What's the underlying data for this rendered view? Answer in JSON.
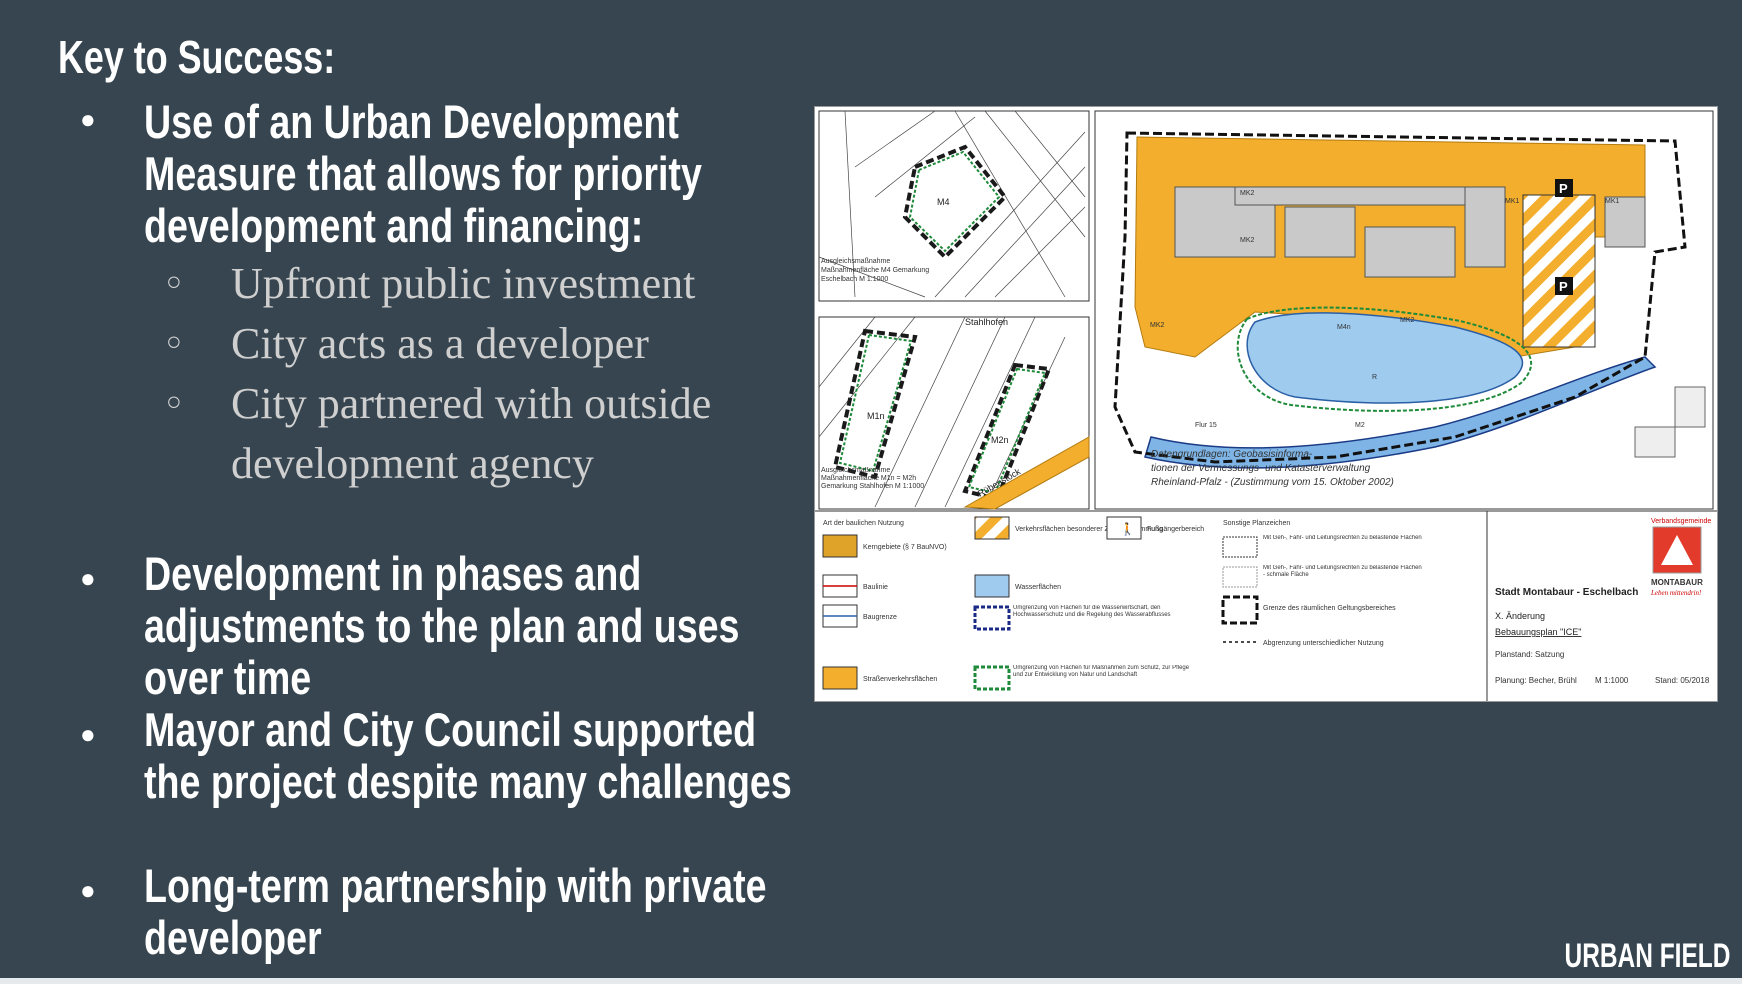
{
  "title": "Key to Success:",
  "bullets": [
    {
      "text": "Use of an Urban Development Measure that allows for priority development and financing:"
    },
    {
      "text": "Development in phases and adjustments to the plan and uses over time"
    },
    {
      "text": "Mayor and City Council supported the project despite many challenges"
    },
    {
      "text": "Long-term partnership with private developer"
    }
  ],
  "sub_bullets": [
    "Upfront public investment",
    "City acts as a developer",
    "City partnered with outside development agency"
  ],
  "footer": "URBAN FIELD",
  "map": {
    "inset1_label": "Ausgleichsmaßnahme Maßnahmenfläche M4 Gemarkung Eschelbach M 1:1000",
    "inset1_mark": "M4",
    "inset2_top": "Stahlhofen",
    "inset2_label": "Ausgleichsmaßnahme Maßnahmenfläche M1n = M2h Gemarkung Stahlhofen M 1:1000",
    "inset2_m1": "M1n",
    "inset2_m2": "M2n",
    "inset2_road": "Rübenstock",
    "main_note1": "Datengrundlagen: Geobasisinforma-",
    "main_note2": "tionen der Vermessungs- und Katasterverwaltung",
    "main_note3": "Rheinland-Pfalz - (Zustimmung vom 15. Oktober 2002)",
    "zone_labels": [
      "MK2",
      "MK2",
      "MK2",
      "MK1",
      "MK1",
      "MK2",
      "M4n",
      "M2",
      "R"
    ],
    "flur": "Flur 15",
    "legend_left": [
      "Art der baulichen Nutzung",
      "Kerngebiete (§ 7 BauNVO)",
      "Baulinie",
      "Baugrenze",
      "Straßenverkehrsflächen"
    ],
    "legend_mid": [
      "Verkehrsflächen besonderer Zweckbestimmung",
      "Fußgängerbereich",
      "Wasserflächen",
      "Umgrenzung von Flächen für die Wasserwirtschaft, den Hochwasserschutz und die Regelung des Wasserabflusses",
      "Umgrenzung von Flächen für Maßnahmen zum Schutz, zur Pflege und zur Entwicklung von Natur und Landschaft"
    ],
    "legend_right": [
      "Sonstige Planzeichen",
      "Mit Geh-, Fahr- und Leitungsrechten zu belastende Flächen",
      "Mit Geh-, Fahr- und Leitungsrechten zu belastende Flächen - schmale Fläche",
      "Grenze des räumlichen Geltungsbereiches",
      "Abgrenzung unterschiedlicher Nutzung"
    ],
    "title_block": {
      "org": "Verbandsgemeinde",
      "city": "MONTABAUR",
      "motto": "Leben mittendrin!",
      "name": "Stadt Montabaur - Eschelbach",
      "change": "X. Änderung",
      "plan": "Bebauungsplan \"ICE\"",
      "status": "Planstand: Satzung",
      "planner": "Planung: Becher, Brühl",
      "scale": "M 1:1000",
      "date": "Stand: 05/2018"
    }
  },
  "colors": {
    "background": "#36454f",
    "orange": "#f2ae2c",
    "water": "#9fcbef",
    "green_boundary": "#1e8a3a"
  }
}
